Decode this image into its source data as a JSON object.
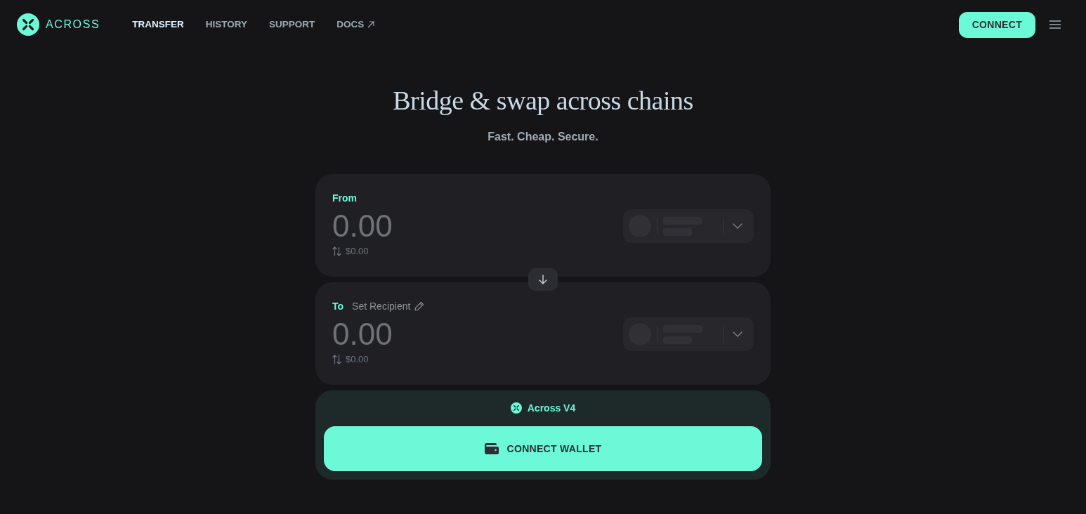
{
  "header": {
    "logo_text": "ACROSS",
    "nav": [
      {
        "label": "TRANSFER",
        "selected": true,
        "external": false
      },
      {
        "label": "HISTORY",
        "selected": false,
        "external": false
      },
      {
        "label": "SUPPORT",
        "selected": false,
        "external": false
      },
      {
        "label": "DOCS",
        "selected": false,
        "external": true
      }
    ],
    "connect_button": "CONNECT"
  },
  "hero": {
    "title": "Bridge & swap across chains",
    "subtitle": "Fast. Cheap. Secure."
  },
  "panels": [
    {
      "label": "From",
      "amount": {
        "placeholder": "0.00"
      },
      "usd_value": "$0.00",
      "token_selector": {
        "loading": true
      }
    },
    {
      "label": "To",
      "recipient_link": "Set Recipient",
      "amount": {
        "placeholder": "0.00"
      },
      "usd_value": "$0.00",
      "token_selector": {
        "loading": true
      }
    }
  ],
  "bridge_panel": {
    "version": "Across V4",
    "button": "CONNECT WALLET"
  }
}
